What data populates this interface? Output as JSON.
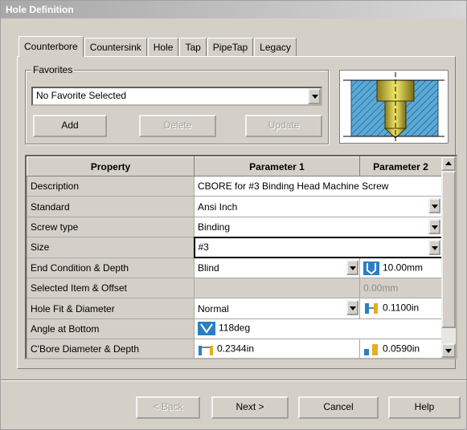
{
  "window": {
    "title": "Hole Definition"
  },
  "tabs": [
    {
      "label": "Counterbore",
      "active": true
    },
    {
      "label": "Countersink",
      "active": false
    },
    {
      "label": "Hole",
      "active": false
    },
    {
      "label": "Tap",
      "active": false
    },
    {
      "label": "PipeTap",
      "active": false
    },
    {
      "label": "Legacy",
      "active": false
    }
  ],
  "favorites": {
    "legend": "Favorites",
    "selected": "No Favorite Selected",
    "add_label": "Add",
    "delete_label": "Delete",
    "update_label": "Update"
  },
  "grid": {
    "headers": {
      "property": "Property",
      "param1": "Parameter 1",
      "param2": "Parameter 2"
    },
    "rows": [
      {
        "property": "Description",
        "p1": "CBORE for #3 Binding Head Machine Screw"
      },
      {
        "property": "Standard",
        "p1": "Ansi Inch"
      },
      {
        "property": "Screw type",
        "p1": "Binding"
      },
      {
        "property": "Size",
        "p1": "#3"
      },
      {
        "property": "End Condition & Depth",
        "p1": "Blind",
        "p2": "10.00mm"
      },
      {
        "property": "Selected Item & Offset",
        "p1": "",
        "p2": "0.00mm"
      },
      {
        "property": "Hole Fit & Diameter",
        "p1": "Normal",
        "p2": "0.1100in"
      },
      {
        "property": "Angle at Bottom",
        "p1": "118deg"
      },
      {
        "property": "C'Bore Diameter & Depth",
        "p1": "0.2344in",
        "p2": "0.0590in"
      }
    ]
  },
  "footer": {
    "back_label": "< Back",
    "next_label": "Next >",
    "cancel_label": "Cancel",
    "help_label": "Help"
  },
  "colors": {
    "hatch_blue": "#5aa9d6",
    "screw_yellow": "#e6d84a",
    "titlebar": "#b4b4b4"
  },
  "icons": [
    "depth-icon",
    "angle-icon",
    "diameter-icon",
    "cbore-diameter-icon",
    "cbore-depth-icon"
  ]
}
